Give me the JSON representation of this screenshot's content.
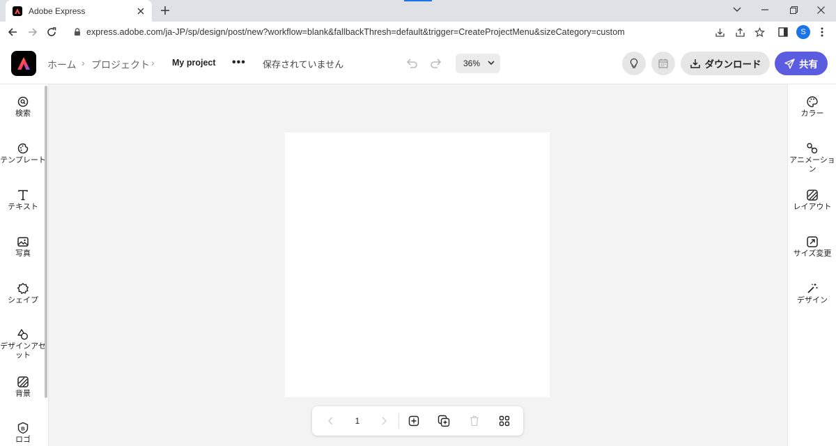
{
  "browser": {
    "tab_title": "Adobe Express",
    "url": "express.adobe.com/ja-JP/sp/design/post/new?workflow=blank&fallbackThresh=default&trigger=CreateProjectMenu&sizeCategory=custom",
    "profile_initial": "S"
  },
  "header": {
    "breadcrumb_home": "ホーム",
    "breadcrumb_projects": "プロジェクト",
    "project_name": "My project",
    "more_label": "•••",
    "save_status": "保存されていません",
    "zoom": "36%",
    "download_label": "ダウンロード",
    "share_label": "共有"
  },
  "left_rail": {
    "items": [
      {
        "label": "検索",
        "icon": "search-icon"
      },
      {
        "label": "テンプレート",
        "icon": "template-icon"
      },
      {
        "label": "テキスト",
        "icon": "text-icon"
      },
      {
        "label": "写真",
        "icon": "photo-icon"
      },
      {
        "label": "シェイプ",
        "icon": "shape-icon"
      },
      {
        "label": "デザインアセット",
        "icon": "design-assets-icon"
      },
      {
        "label": "背景",
        "icon": "background-icon"
      },
      {
        "label": "ロゴ",
        "icon": "logo-icon"
      }
    ]
  },
  "right_rail": {
    "items": [
      {
        "label": "カラー",
        "icon": "palette-icon"
      },
      {
        "label": "アニメーション",
        "icon": "animation-icon"
      },
      {
        "label": "レイアウト",
        "icon": "layout-icon"
      },
      {
        "label": "サイズ変更",
        "icon": "resize-icon"
      },
      {
        "label": "デザイン",
        "icon": "magic-wand-icon"
      }
    ]
  },
  "pagebar": {
    "page_number": "1"
  },
  "colors": {
    "accent": "#5c5ce0",
    "canvas_bg": "#f3f3f3"
  }
}
